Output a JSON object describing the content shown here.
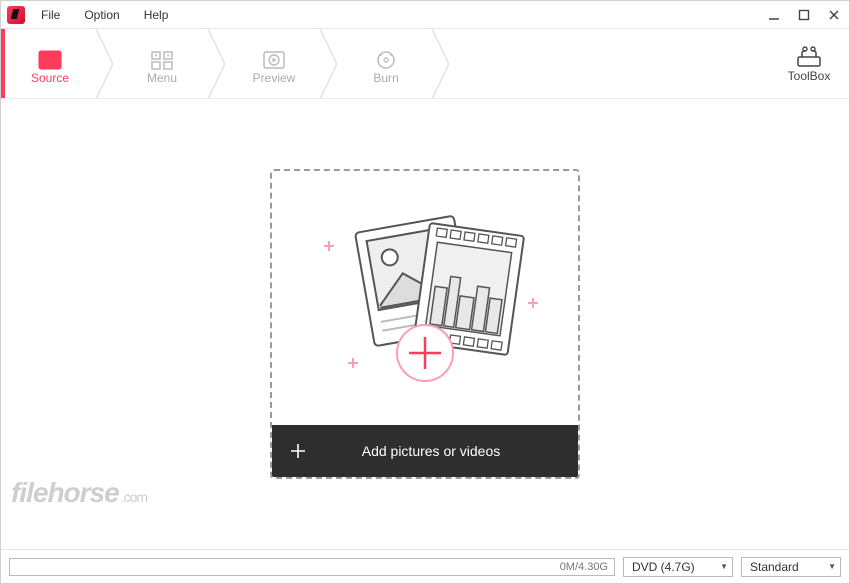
{
  "menubar": {
    "file": "File",
    "option": "Option",
    "help": "Help"
  },
  "steps": {
    "source": "Source",
    "menu": "Menu",
    "preview": "Preview",
    "burn": "Burn"
  },
  "toolbox": {
    "label": "ToolBox"
  },
  "dropzone": {
    "cta": "Add pictures or videos"
  },
  "capacity": {
    "text": "0M/4.30G"
  },
  "disc_select": {
    "value": "DVD (4.7G)"
  },
  "quality_select": {
    "value": "Standard"
  },
  "watermark": {
    "brand": "filehorse",
    "suffix": ".com"
  },
  "colors": {
    "accent": "#ff3b5c"
  }
}
